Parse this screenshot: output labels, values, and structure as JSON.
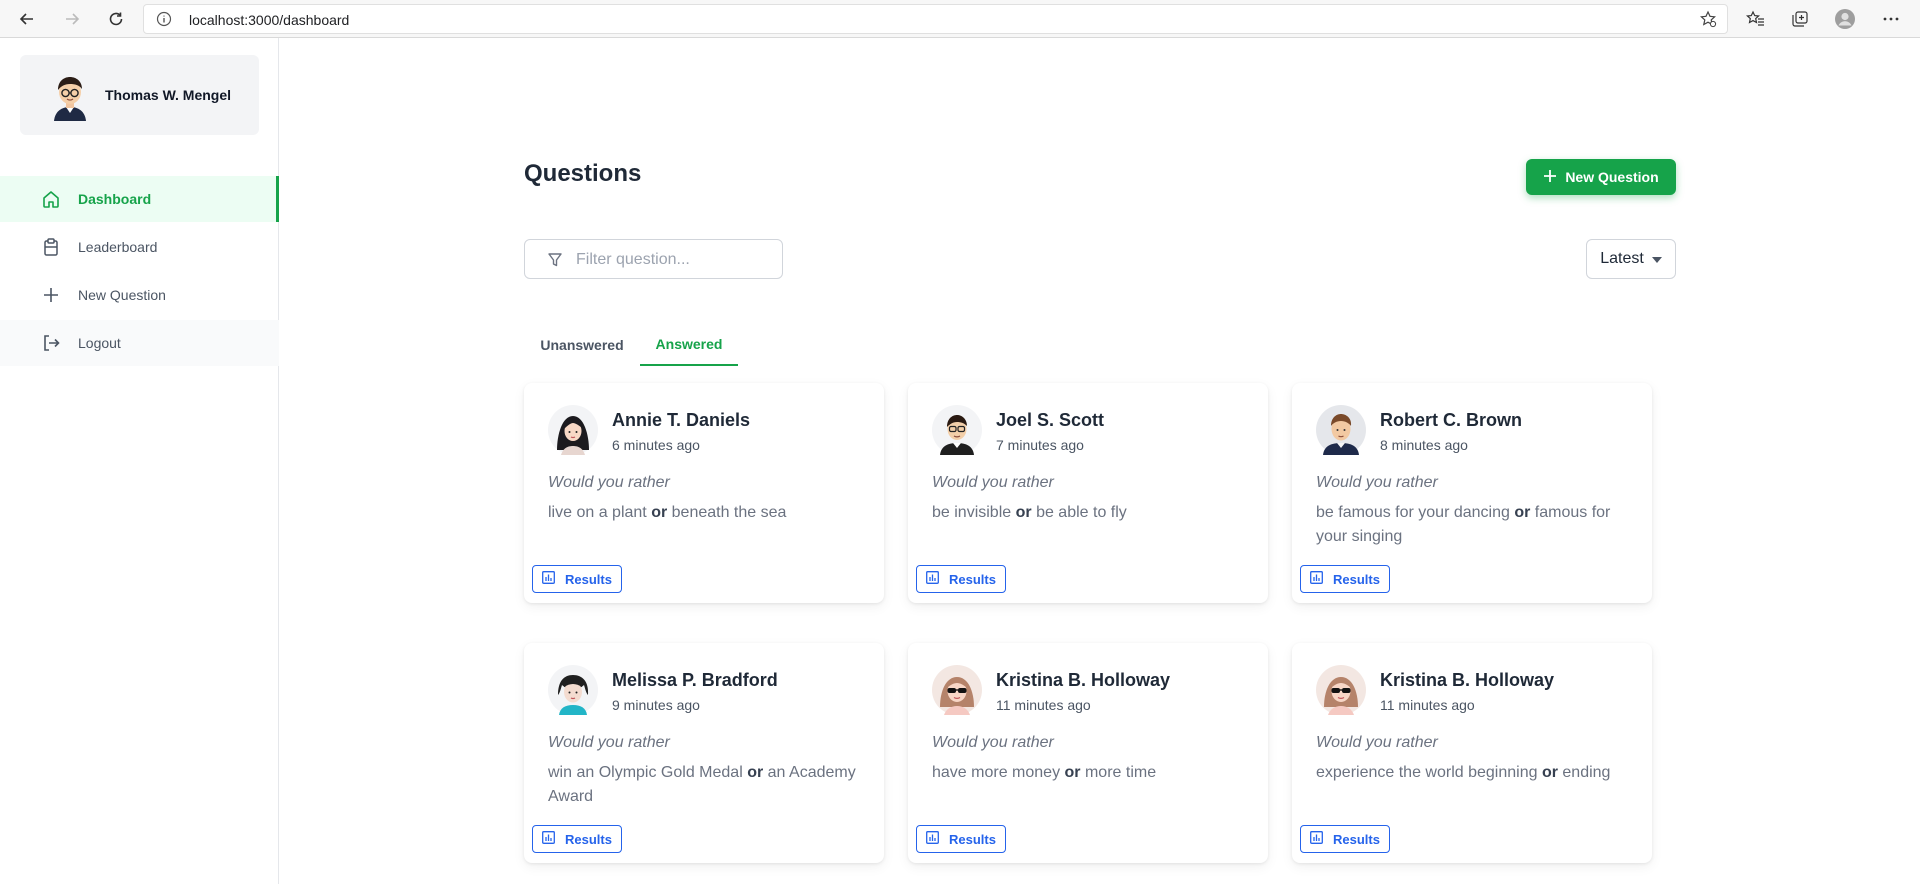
{
  "browser": {
    "url": "localhost:3000/dashboard"
  },
  "sidebar": {
    "user_name": "Thomas W. Mengel",
    "items": [
      {
        "label": "Dashboard",
        "icon": "home-icon",
        "active": true
      },
      {
        "label": "Leaderboard",
        "icon": "clipboard-icon",
        "active": false
      },
      {
        "label": "New Question",
        "icon": "plus-icon",
        "active": false
      },
      {
        "label": "Logout",
        "icon": "logout-icon",
        "active": false
      }
    ]
  },
  "main": {
    "title": "Questions",
    "new_question_label": "New Question",
    "filter_placeholder": "Filter question...",
    "sort_label": "Latest",
    "tabs": [
      {
        "label": "Unanswered",
        "active": false
      },
      {
        "label": "Answered",
        "active": true
      }
    ],
    "prompt": "Would you rather",
    "or_word": "or",
    "results_label": "Results",
    "cards": [
      {
        "author": "Annie T. Daniels",
        "time": "6 minutes ago",
        "option_one": "live on a plant",
        "option_two": "beneath the sea"
      },
      {
        "author": "Joel S. Scott",
        "time": "7 minutes ago",
        "option_one": "be invisible",
        "option_two": "be able to fly"
      },
      {
        "author": "Robert C. Brown",
        "time": "8 minutes ago",
        "option_one": "be famous for your dancing",
        "option_two": "famous for your singing"
      },
      {
        "author": "Melissa P. Bradford",
        "time": "9 minutes ago",
        "option_one": "win an Olympic Gold Medal",
        "option_two": "an Academy Award"
      },
      {
        "author": "Kristina B. Holloway",
        "time": "11 minutes ago",
        "option_one": "have more money",
        "option_two": "more time"
      },
      {
        "author": "Kristina B. Holloway",
        "time": "11 minutes ago",
        "option_one": "experience the world beginning",
        "option_two": "ending"
      }
    ]
  },
  "colors": {
    "accent": "#16a34a",
    "link": "#2563eb"
  }
}
